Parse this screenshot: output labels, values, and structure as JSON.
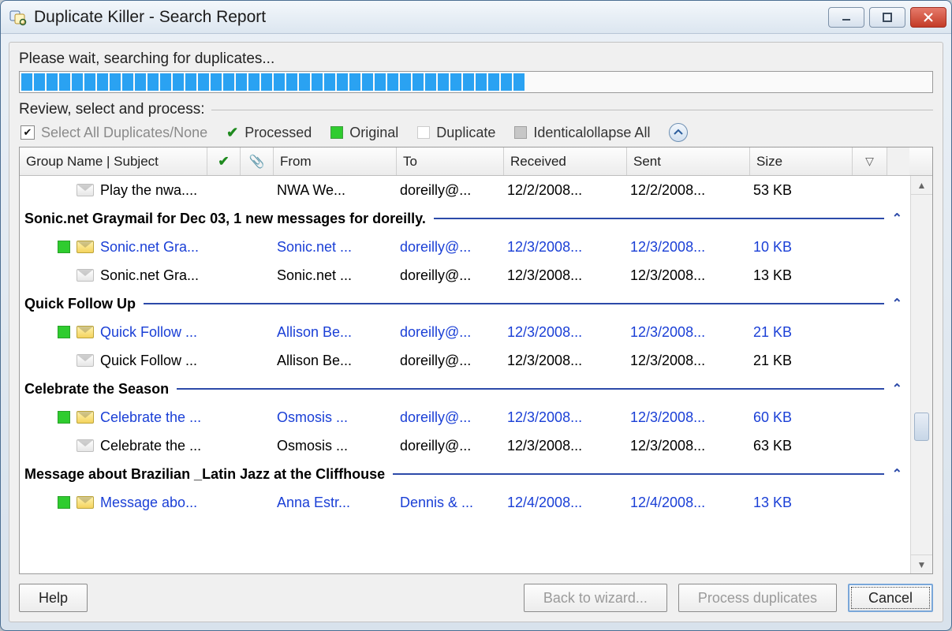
{
  "window": {
    "title": "Duplicate Killer - Search Report"
  },
  "status_text": "Please wait, searching for duplicates...",
  "progress": {
    "filled": 40,
    "total": 80
  },
  "review_label": "Review, select and process:",
  "legend": {
    "select_all": "Select All Duplicates/None",
    "processed": "Processed",
    "original": "Original",
    "duplicate": "Duplicate",
    "identical_collapse": "Identicalollapse All"
  },
  "columns": {
    "subject": "Group Name | Subject",
    "checkmark": "✔",
    "attachment": "📎",
    "from": "From",
    "to": "To",
    "received": "Received",
    "sent": "Sent",
    "size": "Size",
    "filter": "▽"
  },
  "orphan_row": {
    "subject": "Play the nwa....",
    "from": "NWA We...",
    "to": "doreilly@...",
    "received": "12/2/2008...",
    "sent": "12/2/2008...",
    "size": "53 KB"
  },
  "groups": [
    {
      "title": "Sonic.net Graymail for Dec 03, 1 new messages for doreilly.",
      "rows": [
        {
          "original": true,
          "subject": "Sonic.net Gra...",
          "from": "Sonic.net ...",
          "to": "doreilly@...",
          "received": "12/3/2008...",
          "sent": "12/3/2008...",
          "size": "10 KB"
        },
        {
          "original": false,
          "subject": "Sonic.net Gra...",
          "from": "Sonic.net ...",
          "to": "doreilly@...",
          "received": "12/3/2008...",
          "sent": "12/3/2008...",
          "size": "13 KB"
        }
      ]
    },
    {
      "title": "Quick Follow Up",
      "rows": [
        {
          "original": true,
          "subject": "Quick Follow ...",
          "from": "Allison Be...",
          "to": "doreilly@...",
          "received": "12/3/2008...",
          "sent": "12/3/2008...",
          "size": "21 KB"
        },
        {
          "original": false,
          "subject": "Quick Follow ...",
          "from": "Allison Be...",
          "to": "doreilly@...",
          "received": "12/3/2008...",
          "sent": "12/3/2008...",
          "size": "21 KB"
        }
      ]
    },
    {
      "title": "Celebrate the Season",
      "rows": [
        {
          "original": true,
          "subject": "Celebrate the ...",
          "from": "Osmosis ...",
          "to": "doreilly@...",
          "received": "12/3/2008...",
          "sent": "12/3/2008...",
          "size": "60 KB"
        },
        {
          "original": false,
          "subject": "Celebrate the ...",
          "from": "Osmosis ...",
          "to": "doreilly@...",
          "received": "12/3/2008...",
          "sent": "12/3/2008...",
          "size": "63 KB"
        }
      ]
    },
    {
      "title": "Message about Brazilian _Latin Jazz at the Cliffhouse",
      "rows": [
        {
          "original": true,
          "subject": "Message abo...",
          "from": "Anna Estr...",
          "to": "Dennis & ...",
          "received": "12/4/2008...",
          "sent": "12/4/2008...",
          "size": "13 KB"
        }
      ]
    }
  ],
  "buttons": {
    "help": "Help",
    "back": "Back to wizard...",
    "process": "Process duplicates",
    "cancel": "Cancel"
  }
}
